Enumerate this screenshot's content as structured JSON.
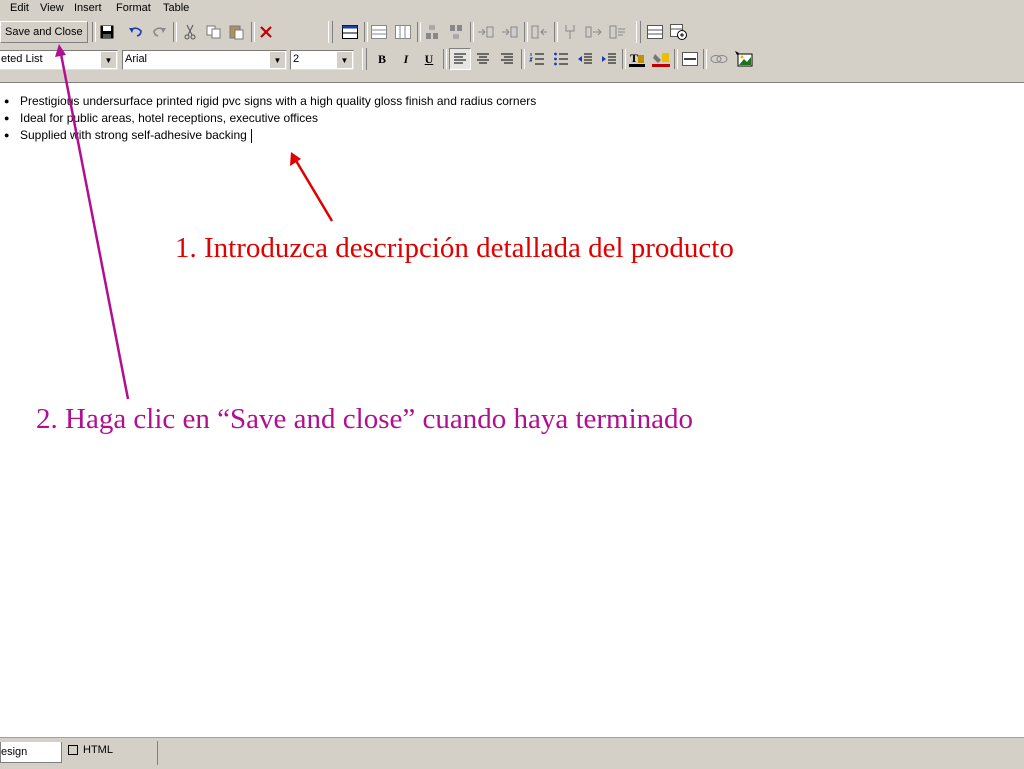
{
  "menu": {
    "items": [
      "Edit",
      "View",
      "Insert",
      "Format",
      "Table"
    ]
  },
  "toolbar": {
    "save_close_label": "Save and Close",
    "style_value": "eted List",
    "font_value": "Arial",
    "size_value": "2",
    "bold_label": "B",
    "italic_label": "I",
    "underline_label": "U"
  },
  "editor": {
    "bullets": [
      "Prestigious undersurface printed rigid pvc signs with a high quality gloss finish and radius corners",
      "Ideal for public areas, hotel receptions, executive offices",
      "Supplied with strong self-adhesive backing"
    ]
  },
  "annotations": {
    "step1": "1. Introduzca descripción detallada del producto",
    "step2": "2. Haga clic en “Save and close” cuando haya terminado",
    "step1_color": "#e00000",
    "step2_color": "#b01090"
  },
  "status": {
    "design_tab": "esign",
    "html_tab": "HTML"
  }
}
